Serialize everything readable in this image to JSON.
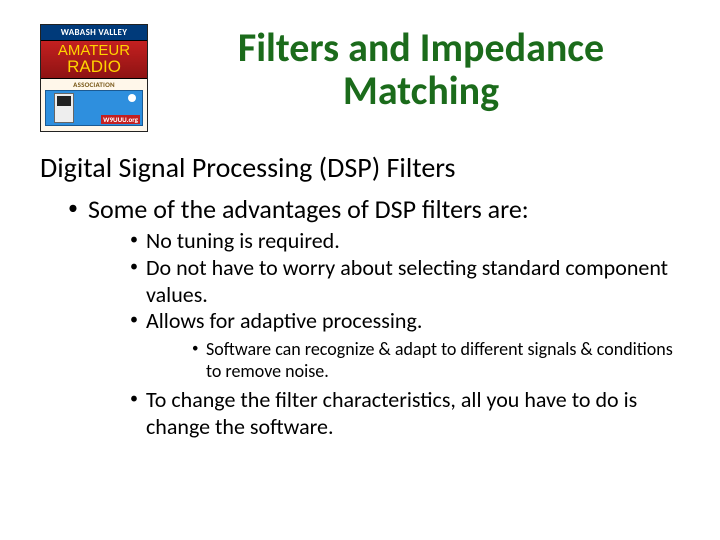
{
  "logo": {
    "top": "WABASH VALLEY",
    "line1": "AMATEUR",
    "line2": "RADIO",
    "assoc": "ASSOCIATION",
    "url": "W9UUU.org"
  },
  "title": "Filters and Impedance Matching",
  "subtitle": "Digital Signal Processing (DSP) Filters",
  "lvl1_0": "Some of the advantages of DSP filters are:",
  "lvl2_0": "No tuning is required.",
  "lvl2_1": "Do not have to worry about selecting standard component values.",
  "lvl2_2": "Allows for adaptive processing.",
  "lvl3_0": "Software can recognize & adapt to different signals & conditions to remove noise.",
  "lvl2_3": "To change the filter characteristics, all you have to do is change the software."
}
